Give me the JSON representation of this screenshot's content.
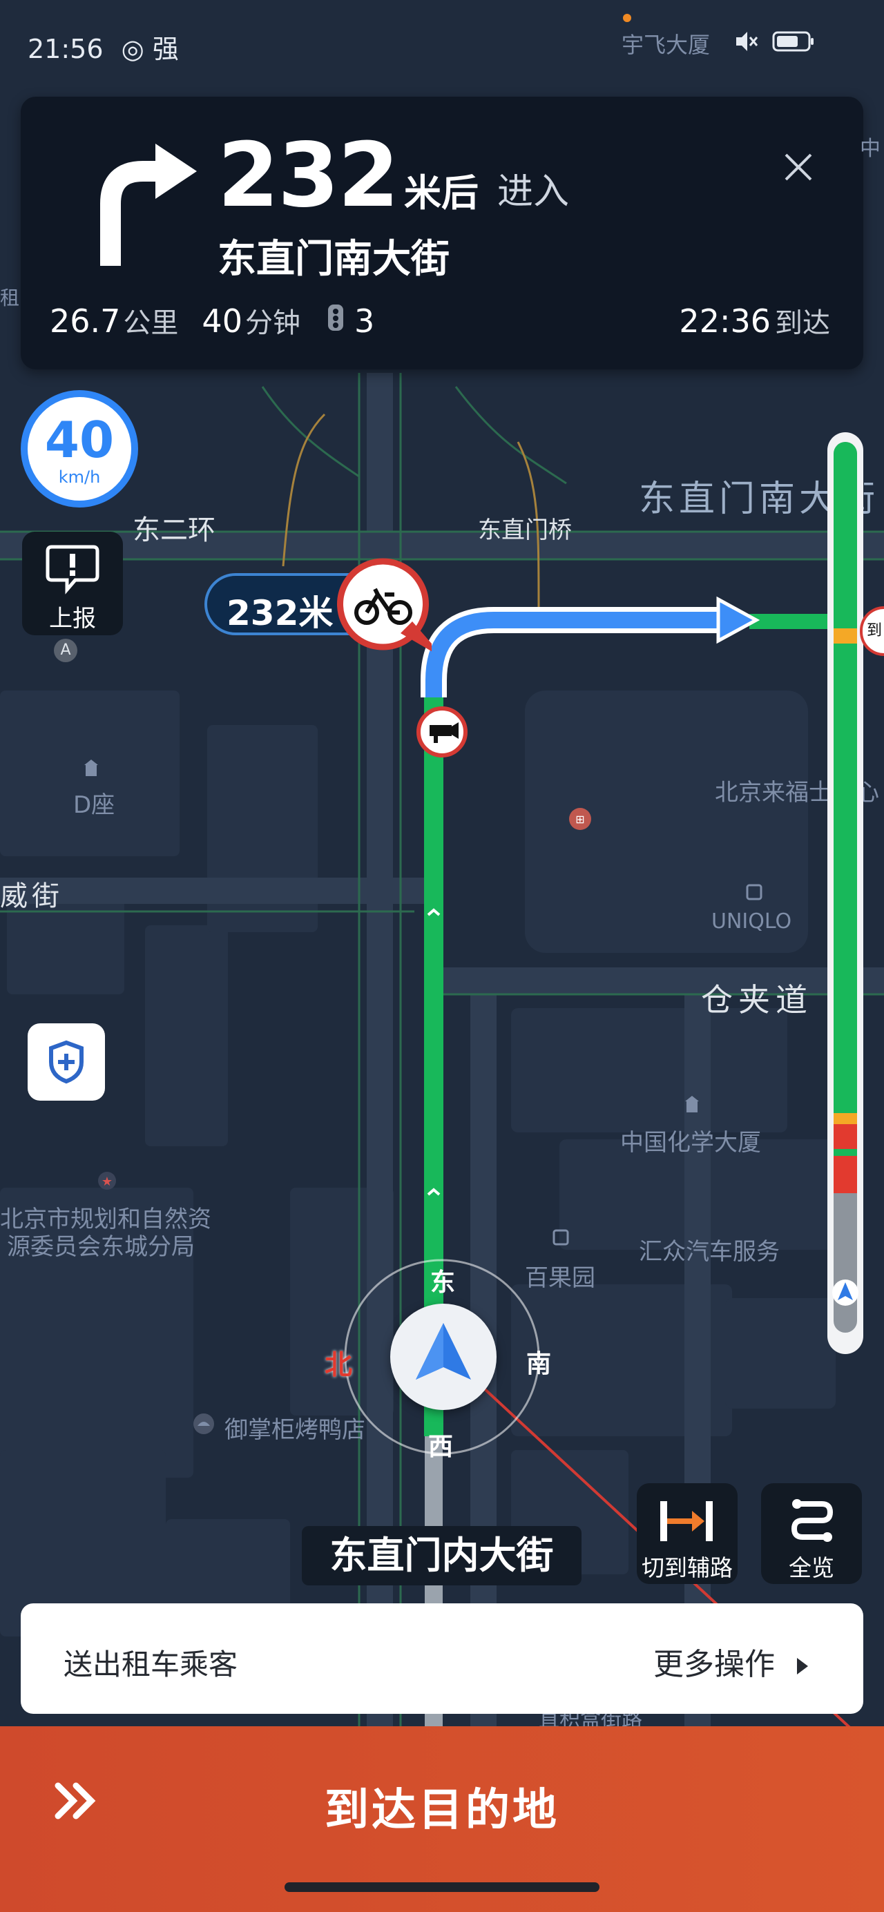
{
  "status_bar": {
    "time": "21:56",
    "signal_label": "强"
  },
  "nav_card": {
    "distance_value": "232",
    "distance_unit": "米后",
    "action_verb": "进入",
    "next_street": "东直门南大街",
    "remaining_distance": "26.7",
    "remaining_distance_unit": "公里",
    "remaining_time": "40",
    "remaining_time_unit": "分钟",
    "traffic_lights": "3",
    "arrival_time": "22:36",
    "arrival_label": "到达"
  },
  "speed_limit": {
    "value": "40",
    "unit": "km/h"
  },
  "report_button": {
    "label": "上报",
    "badge": "A"
  },
  "camera_bubble": {
    "distance": "232米"
  },
  "map_labels": {
    "top_poi": "宇飞大厦",
    "ring_road": "东二环",
    "bridge": "东直门桥",
    "big_street": "东直门南大街",
    "d_block": "D座",
    "wei_street": "威街",
    "laifu": "北京来福士中心",
    "uniqlo": "UNIQLO",
    "cangjiadao": "仓夹道",
    "chem_building": "中国化学大厦",
    "planning_bureau_1": "北京市规划和自然资",
    "planning_bureau_2": "源委员会东城分局",
    "baiguoyuan": "百果园",
    "huizhong": "汇众汽车服务",
    "yuzhanggui": "御掌柜烤鸭店",
    "zhongzhou": "中",
    "zujie": "租",
    "bottom_poi": "直积盒街路",
    "right_edge": "到速"
  },
  "compass": {
    "north": "北",
    "east": "东",
    "south": "南",
    "west": "西"
  },
  "current_road": "东直门内大街",
  "controls": {
    "switch_side_road": "切到辅路",
    "overview": "全览"
  },
  "action_bar": {
    "left_label": "送出租车乘客",
    "right_label": "更多操作"
  },
  "arrive_button": {
    "label": "到达目的地"
  },
  "traffic_bar": {
    "segments": [
      "green",
      "orange",
      "green",
      "orange",
      "red",
      "green",
      "red"
    ]
  },
  "colors": {
    "route_green": "#18b85a",
    "route_blue": "#3d8ef7",
    "speed_blue": "#2f86f6",
    "arrive_red": "#d04d2d",
    "map_bg": "#1f2b3d"
  }
}
